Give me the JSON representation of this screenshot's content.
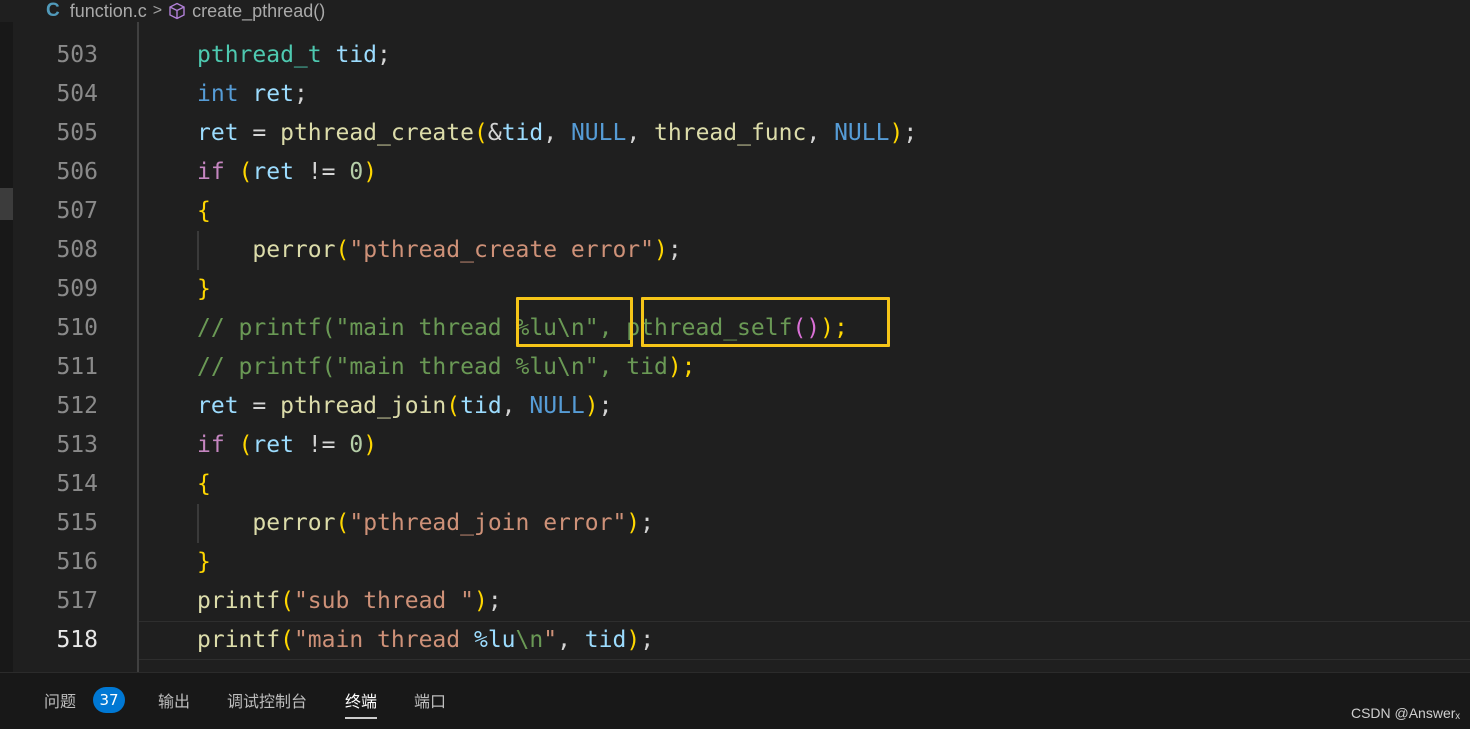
{
  "breadcrumb": {
    "file_icon": "C",
    "file_name": "function.c",
    "separator": ">",
    "symbol_icon": "cube-icon",
    "symbol_name": "create_pthread()"
  },
  "editor": {
    "active_line": 518,
    "lines": [
      {
        "num": "503",
        "tokens": [
          {
            "t": "pthread_t",
            "c": "type"
          },
          {
            "t": " "
          },
          {
            "t": "tid",
            "c": "var"
          },
          {
            "t": ";"
          }
        ]
      },
      {
        "num": "504",
        "tokens": [
          {
            "t": "int",
            "c": "kw"
          },
          {
            "t": " "
          },
          {
            "t": "ret",
            "c": "var"
          },
          {
            "t": ";"
          }
        ]
      },
      {
        "num": "505",
        "tokens": [
          {
            "t": "ret",
            "c": "var"
          },
          {
            "t": " = "
          },
          {
            "t": "pthread_create",
            "c": "fn"
          },
          {
            "t": "(",
            "c": "b1"
          },
          {
            "t": "&"
          },
          {
            "t": "tid",
            "c": "var"
          },
          {
            "t": ", "
          },
          {
            "t": "NULL",
            "c": "kw"
          },
          {
            "t": ", "
          },
          {
            "t": "thread_func",
            "c": "fn"
          },
          {
            "t": ", "
          },
          {
            "t": "NULL",
            "c": "kw"
          },
          {
            "t": ")",
            "c": "b1"
          },
          {
            "t": ";"
          }
        ]
      },
      {
        "num": "506",
        "tokens": [
          {
            "t": "if",
            "c": "ctl"
          },
          {
            "t": " "
          },
          {
            "t": "(",
            "c": "b1"
          },
          {
            "t": "ret",
            "c": "var"
          },
          {
            "t": " != "
          },
          {
            "t": "0",
            "c": "num"
          },
          {
            "t": ")",
            "c": "b1"
          }
        ]
      },
      {
        "num": "507",
        "tokens": [
          {
            "t": "{",
            "c": "b1"
          }
        ]
      },
      {
        "num": "508",
        "tokens": [
          {
            "t": "    "
          },
          {
            "t": "perror",
            "c": "fn"
          },
          {
            "t": "(",
            "c": "b1"
          },
          {
            "t": "\"pthread_create error\"",
            "c": "str"
          },
          {
            "t": ")",
            "c": "b1"
          },
          {
            "t": ";"
          }
        ]
      },
      {
        "num": "509",
        "tokens": [
          {
            "t": "}",
            "c": "b1"
          }
        ]
      },
      {
        "num": "510",
        "tokens": [
          {
            "t": "// printf(\"main thread %lu\\n\", pthread_self",
            "c": "cm"
          },
          {
            "t": "()",
            "c": "b2"
          },
          {
            "t": ");",
            "c": "b1"
          }
        ]
      },
      {
        "num": "511",
        "tokens": [
          {
            "t": "// printf(\"main thread %lu\\n\", tid",
            "c": "cm"
          },
          {
            "t": ");",
            "c": "b1"
          }
        ]
      },
      {
        "num": "512",
        "tokens": [
          {
            "t": "ret",
            "c": "var"
          },
          {
            "t": " = "
          },
          {
            "t": "pthread_join",
            "c": "fn"
          },
          {
            "t": "(",
            "c": "b1"
          },
          {
            "t": "tid",
            "c": "var"
          },
          {
            "t": ", "
          },
          {
            "t": "NULL",
            "c": "kw"
          },
          {
            "t": ")",
            "c": "b1"
          },
          {
            "t": ";"
          }
        ]
      },
      {
        "num": "513",
        "tokens": [
          {
            "t": "if",
            "c": "ctl"
          },
          {
            "t": " "
          },
          {
            "t": "(",
            "c": "b1"
          },
          {
            "t": "ret",
            "c": "var"
          },
          {
            "t": " != "
          },
          {
            "t": "0",
            "c": "num"
          },
          {
            "t": ")",
            "c": "b1"
          }
        ]
      },
      {
        "num": "514",
        "tokens": [
          {
            "t": "{",
            "c": "b1"
          }
        ]
      },
      {
        "num": "515",
        "tokens": [
          {
            "t": "    "
          },
          {
            "t": "perror",
            "c": "fn"
          },
          {
            "t": "(",
            "c": "b1"
          },
          {
            "t": "\"pthread_join error\"",
            "c": "str"
          },
          {
            "t": ")",
            "c": "b1"
          },
          {
            "t": ";"
          }
        ]
      },
      {
        "num": "516",
        "tokens": [
          {
            "t": "}",
            "c": "b1"
          }
        ]
      },
      {
        "num": "517",
        "tokens": [
          {
            "t": "printf",
            "c": "fn"
          },
          {
            "t": "(",
            "c": "b1"
          },
          {
            "t": "\"sub thread \"",
            "c": "str"
          },
          {
            "t": ")",
            "c": "b1"
          },
          {
            "t": ";"
          }
        ]
      },
      {
        "num": "518",
        "tokens": [
          {
            "t": "printf",
            "c": "fn"
          },
          {
            "t": "(",
            "c": "b1"
          },
          {
            "t": "\"main thread ",
            "c": "str"
          },
          {
            "t": "%lu",
            "c": "var"
          },
          {
            "t": "\\n",
            "c": "cm"
          },
          {
            "t": "\"",
            "c": "str"
          },
          {
            "t": ", "
          },
          {
            "t": "tid",
            "c": "var"
          },
          {
            "t": ")",
            "c": "b1"
          },
          {
            "t": ";"
          }
        ]
      }
    ]
  },
  "panel": {
    "tabs": [
      {
        "id": "problems",
        "label": "问题",
        "badge": "37"
      },
      {
        "id": "output",
        "label": "输出"
      },
      {
        "id": "debug-console",
        "label": "调试控制台"
      },
      {
        "id": "terminal",
        "label": "终端",
        "active": true
      },
      {
        "id": "ports",
        "label": "端口"
      }
    ],
    "watermark": "CSDN @Answerₓ"
  },
  "colors": {
    "highlight_box": "#f5c518",
    "badge": "#0078d4"
  }
}
